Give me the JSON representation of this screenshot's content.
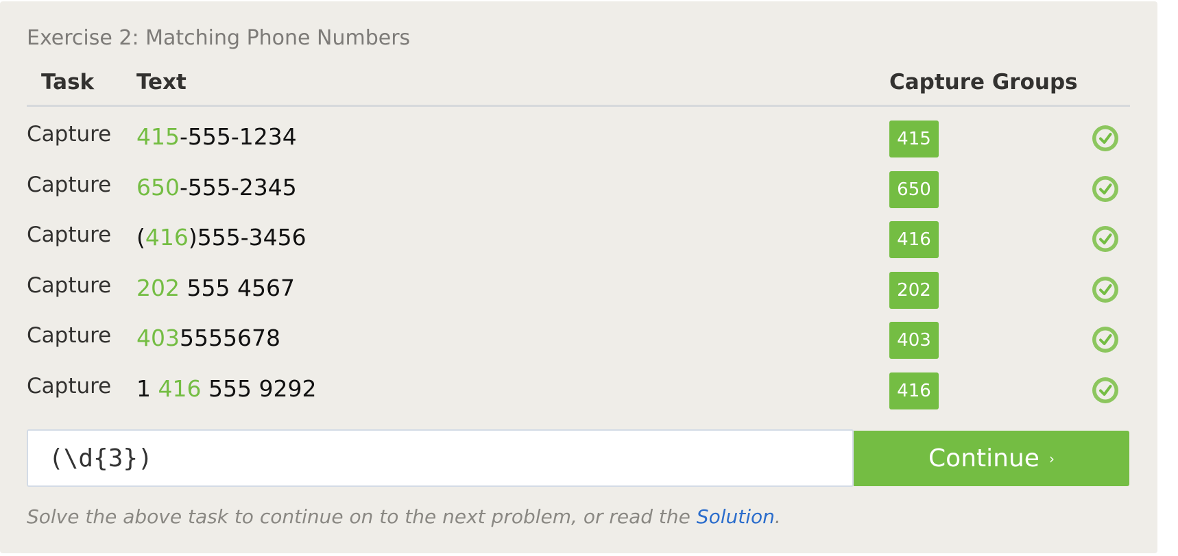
{
  "exercise": {
    "title": "Exercise 2: Matching Phone Numbers"
  },
  "table": {
    "headers": {
      "task": "Task",
      "text": "Text",
      "capture_groups": "Capture Groups"
    },
    "rows": [
      {
        "task": "Capture",
        "parts": [
          {
            "t": "415",
            "hl": true
          },
          {
            "t": "-555-1234",
            "hl": false
          }
        ],
        "group": "415",
        "status": "check-circle-icon"
      },
      {
        "task": "Capture",
        "parts": [
          {
            "t": "650",
            "hl": true
          },
          {
            "t": "-555-2345",
            "hl": false
          }
        ],
        "group": "650",
        "status": "check-circle-icon"
      },
      {
        "task": "Capture",
        "parts": [
          {
            "t": "(",
            "hl": false
          },
          {
            "t": "416",
            "hl": true
          },
          {
            "t": ")555-3456",
            "hl": false
          }
        ],
        "group": "416",
        "status": "check-circle-icon"
      },
      {
        "task": "Capture",
        "parts": [
          {
            "t": "202",
            "hl": true
          },
          {
            "t": " 555 4567",
            "hl": false
          }
        ],
        "group": "202",
        "status": "check-circle-icon"
      },
      {
        "task": "Capture",
        "parts": [
          {
            "t": "403",
            "hl": true
          },
          {
            "t": "5555678",
            "hl": false
          }
        ],
        "group": "403",
        "status": "check-circle-icon"
      },
      {
        "task": "Capture",
        "parts": [
          {
            "t": "1 ",
            "hl": false
          },
          {
            "t": "416",
            "hl": true
          },
          {
            "t": " 555 9292",
            "hl": false
          }
        ],
        "group": "416",
        "status": "check-circle-icon"
      }
    ]
  },
  "input": {
    "value": "(\\d{3})",
    "placeholder": ""
  },
  "continue_button": {
    "label": "Continue",
    "chevron": "›"
  },
  "footer": {
    "prefix": "Solve the above task to continue on to the next problem, or read the ",
    "link": "Solution",
    "suffix": "."
  },
  "colors": {
    "accent": "#74bd43",
    "panel_bg": "#efede8",
    "link": "#2b6dcc"
  }
}
